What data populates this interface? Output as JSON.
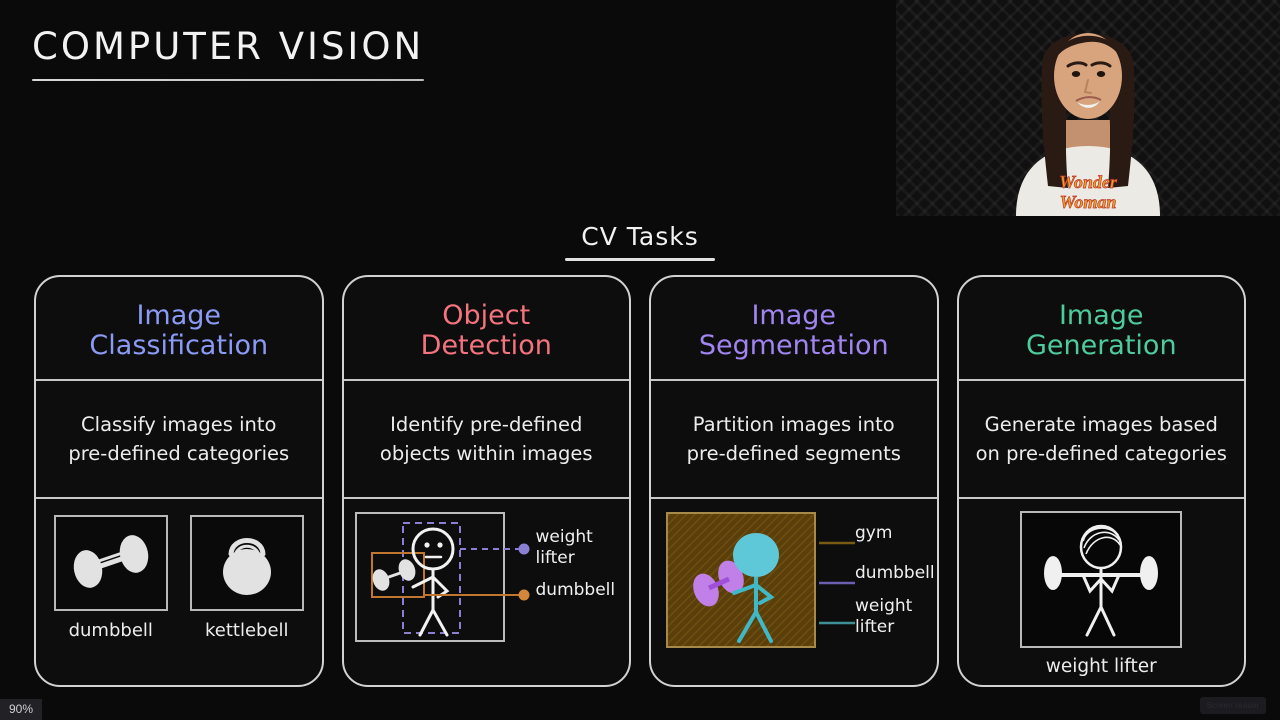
{
  "slide": {
    "title": "COMPUTER VISION",
    "section_title": "CV Tasks"
  },
  "colors": {
    "background": "#0a0a0a",
    "stroke": "#d2d2d2",
    "classification": "#8b9bf5",
    "detection": "#f5737f",
    "segmentation": "#a084f0",
    "generation": "#4ecb9c",
    "detection_box_person": "#8b7fd4",
    "detection_box_dumbbell": "#d4863a",
    "segment_gym": "#7a5a12",
    "segment_dumbbell": "#c080e8",
    "segment_person": "#5ec8d8"
  },
  "cards": [
    {
      "title_line1": "Image",
      "title_line2": "Classification",
      "color": "#8b9bf5",
      "desc_line1": "Classify images into",
      "desc_line2": "pre-defined categories",
      "thumbs": [
        {
          "label": "dumbbell",
          "icon": "dumbbell-icon"
        },
        {
          "label": "kettlebell",
          "icon": "kettlebell-icon"
        }
      ]
    },
    {
      "title_line1": "Object",
      "title_line2": "Detection",
      "color": "#f5737f",
      "desc_line1": "Identify pre-defined",
      "desc_line2": "objects within images",
      "legend": [
        {
          "label_line1": "weight",
          "label_line2": "lifter",
          "color": "#8b7fd4",
          "marker": "dot"
        },
        {
          "label_line1": "dumbbell",
          "label_line2": "",
          "color": "#d4863a",
          "marker": "dot"
        }
      ]
    },
    {
      "title_line1": "Image",
      "title_line2": "Segmentation",
      "color": "#a084f0",
      "desc_line1": "Partition images into",
      "desc_line2": "pre-defined segments",
      "legend": [
        {
          "label_line1": "gym",
          "label_line2": "",
          "color": "#7a5a12",
          "marker": "line"
        },
        {
          "label_line1": "dumbbell",
          "label_line2": "",
          "color": "#6c5fb0",
          "marker": "line"
        },
        {
          "label_line1": "weight",
          "label_line2": "lifter",
          "color": "#3f8f96",
          "marker": "line"
        }
      ]
    },
    {
      "title_line1": "Image",
      "title_line2": "Generation",
      "color": "#4ecb9c",
      "desc_line1": "Generate images based",
      "desc_line2": "on pre-defined categories",
      "thumbs": [
        {
          "label": "weight lifter",
          "icon": "weightlifter-icon"
        }
      ]
    }
  ],
  "webcam": {
    "present": true,
    "shirt_text_line1": "Wonder",
    "shirt_text_line2": "Woman"
  },
  "statusbar": {
    "zoom_level": "90%",
    "right_button_label": "Screen reader"
  }
}
